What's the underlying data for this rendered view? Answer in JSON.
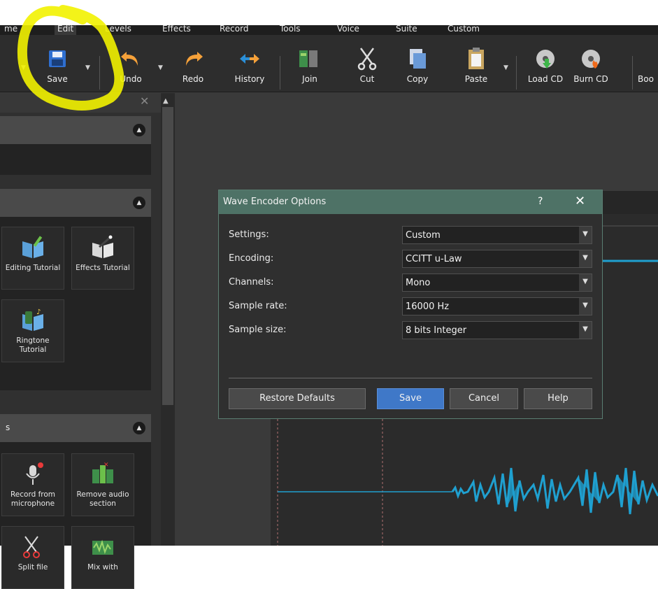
{
  "menu": {
    "items": [
      {
        "label": "me"
      },
      {
        "label": "Edit"
      },
      {
        "label": "Levels"
      },
      {
        "label": "Effects"
      },
      {
        "label": "Record"
      },
      {
        "label": "Tools"
      },
      {
        "label": "Voice"
      },
      {
        "label": "Suite"
      },
      {
        "label": "Custom"
      }
    ]
  },
  "toolbar": {
    "save": "Save",
    "undo": "Undo",
    "redo": "Redo",
    "history": "History",
    "join": "Join",
    "cut": "Cut",
    "copy": "Copy",
    "paste": "Paste",
    "load_cd": "Load CD",
    "burn_cd": "Burn CD",
    "boo": "Boo"
  },
  "left_panel": {
    "section_2_tiles": [
      {
        "label": "Editing Tutorial"
      },
      {
        "label": "Effects Tutorial"
      },
      {
        "label": "Ringtone Tutorial"
      }
    ],
    "section_3_title": "s",
    "section_3_tiles": [
      {
        "label": "Record from microphone"
      },
      {
        "label": "Remove audio section"
      },
      {
        "label": "Split file"
      },
      {
        "label": "Mix with"
      }
    ]
  },
  "dialog": {
    "title": "Wave Encoder Options",
    "help_glyph": "?",
    "close_glyph": "✕",
    "fields": [
      {
        "label": "Settings:",
        "value": "Custom"
      },
      {
        "label": "Encoding:",
        "value": "CCITT u-Law"
      },
      {
        "label": "Channels:",
        "value": "Mono"
      },
      {
        "label": "Sample rate:",
        "value": "16000 Hz"
      },
      {
        "label": "Sample size:",
        "value": "8 bits Integer"
      }
    ],
    "buttons": {
      "restore": "Restore Defaults",
      "save": "Save",
      "cancel": "Cancel",
      "help": "Help"
    }
  },
  "colors": {
    "accent": "#3f78c8",
    "dialog_title": "#4e7266",
    "waveform": "#1fa0d0",
    "highlight": "#f2f200"
  }
}
